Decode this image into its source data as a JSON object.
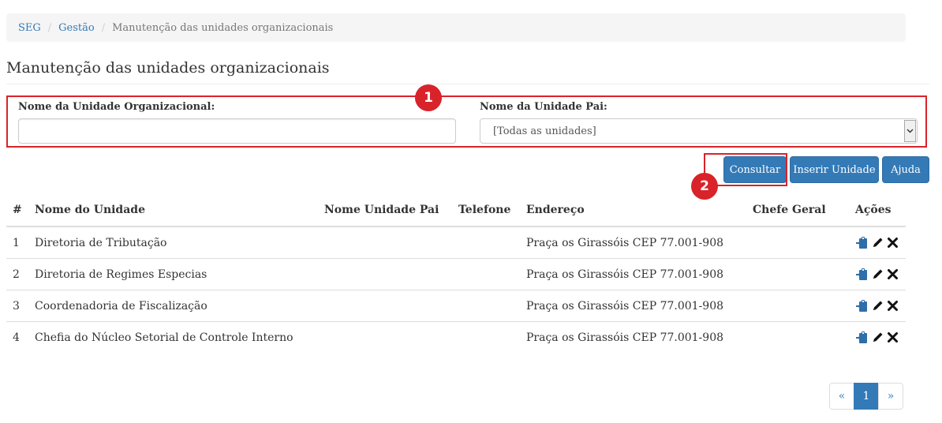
{
  "breadcrumb": {
    "items": [
      "SEG",
      "Gestão"
    ],
    "separator": "/",
    "current": "Manutenção das unidades organizacionais"
  },
  "page_title": "Manutenção das unidades organizacionais",
  "filters": {
    "unit_name_label": "Nome da Unidade Organizacional:",
    "unit_name_value": "",
    "parent_unit_label": "Nome da Unidade Pai:",
    "parent_unit_selected": "[Todas as unidades]"
  },
  "annotations": {
    "badge1": "1",
    "badge2": "2"
  },
  "buttons": {
    "consultar": "Consultar",
    "inserir": "Inserir Unidade",
    "ajuda": "Ajuda"
  },
  "table": {
    "headers": {
      "num": "#",
      "nome": "Nome do Unidade",
      "pai": "Nome Unidade Pai",
      "telefone": "Telefone",
      "endereco": "Endereço",
      "chefe": "Chefe Geral",
      "acoes": "Ações"
    },
    "rows": [
      {
        "num": "1",
        "nome": "Diretoria de Tributação",
        "pai": "",
        "telefone": "",
        "endereco": "Praça os Girassóis CEP 77.001-908",
        "chefe": ""
      },
      {
        "num": "2",
        "nome": "Diretoria de Regimes Especias",
        "pai": "",
        "telefone": "",
        "endereco": "Praça os Girassóis CEP 77.001-908",
        "chefe": ""
      },
      {
        "num": "3",
        "nome": "Coordenadoria de Fiscalização",
        "pai": "",
        "telefone": "",
        "endereco": "Praça os Girassóis CEP 77.001-908",
        "chefe": ""
      },
      {
        "num": "4",
        "nome": "Chefia do Núcleo Setorial de Controle Interno",
        "pai": "",
        "telefone": "",
        "endereco": "Praça os Girassóis CEP 77.001-908",
        "chefe": ""
      }
    ],
    "action_icons": [
      "clipboard-import-icon",
      "pencil-icon",
      "close-icon"
    ]
  },
  "pagination": {
    "prev": "«",
    "current": "1",
    "next": "»"
  },
  "colors": {
    "primary": "#337ab7",
    "highlight": "#d9232a",
    "icon_blue": "#2f6ea8"
  }
}
